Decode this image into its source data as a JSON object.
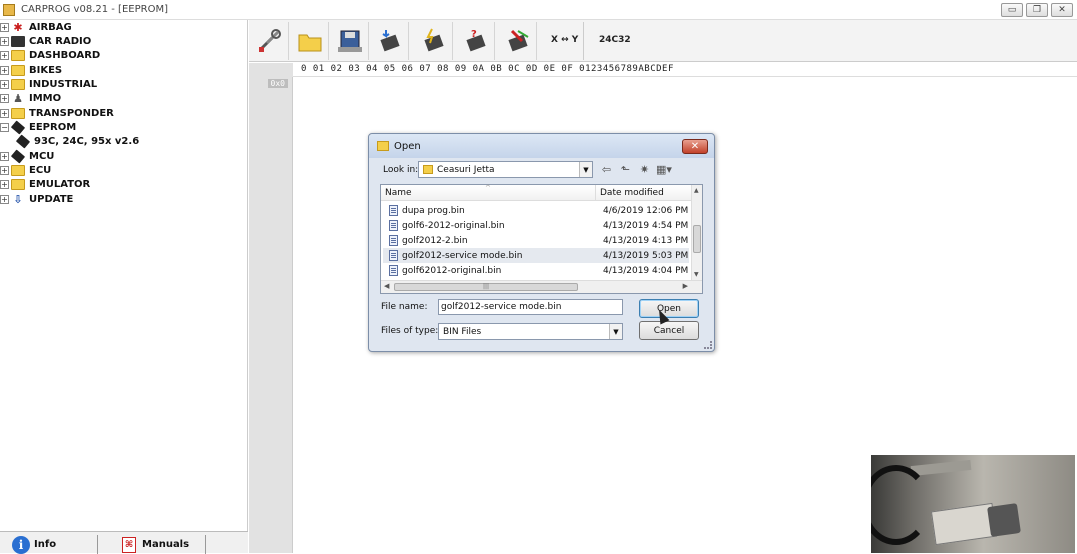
{
  "window": {
    "title": "CARPROG  v08.21 - [EEPROM]",
    "buttons": [
      "▭",
      "❐",
      "✕"
    ]
  },
  "tree": [
    {
      "label": "AIRBAG",
      "icon": "airbag-icon",
      "expander": "+"
    },
    {
      "label": "CAR RADIO",
      "icon": "car-radio-icon",
      "expander": "+"
    },
    {
      "label": "DASHBOARD",
      "icon": "folder-icon",
      "expander": "+"
    },
    {
      "label": "BIKES",
      "icon": "folder-icon",
      "expander": "+"
    },
    {
      "label": "INDUSTRIAL",
      "icon": "folder-icon",
      "expander": "+"
    },
    {
      "label": "IMMO",
      "icon": "person-icon",
      "expander": "+"
    },
    {
      "label": "TRANSPONDER",
      "icon": "folder-icon",
      "expander": "+"
    },
    {
      "label": "EEPROM",
      "icon": "chip-icon",
      "expander": "−"
    },
    {
      "label": "93C, 24C, 95x v2.6",
      "icon": "chip-icon",
      "expander": ""
    },
    {
      "label": "MCU",
      "icon": "chip-icon",
      "expander": "+"
    },
    {
      "label": "ECU",
      "icon": "folder-icon",
      "expander": "+"
    },
    {
      "label": "EMULATOR",
      "icon": "folder-icon",
      "expander": "+"
    },
    {
      "label": "UPDATE",
      "icon": "update-icon",
      "expander": "+"
    }
  ],
  "sidebar_bottom": {
    "info": "Info",
    "manuals": "Manuals"
  },
  "toolbar": {
    "xy_label": "X ↔ Y",
    "device": "24C32"
  },
  "hex": {
    "header": "0 01 02 03 04 05 06 07 08 09 0A 0B 0C 0D 0E 0F   0123456789ABCDEF",
    "first_address": "0x0"
  },
  "dialog": {
    "title": "Open",
    "look_in_label": "Look in:",
    "look_in_value": "Ceasuri Jetta",
    "col_name": "Name",
    "col_date": "Date modified",
    "files": [
      {
        "name": "dupa prog.bin",
        "date": "4/6/2019 12:06 PM"
      },
      {
        "name": "golf6-2012-original.bin",
        "date": "4/13/2019 4:54 PM"
      },
      {
        "name": "golf2012-2.bin",
        "date": "4/13/2019 4:13 PM"
      },
      {
        "name": "golf2012-service mode.bin",
        "date": "4/13/2019 5:03 PM"
      },
      {
        "name": "golf62012-original.bin",
        "date": "4/13/2019 4:04 PM"
      }
    ],
    "file_name_label": "File name:",
    "file_name_value": "golf2012-service mode.bin",
    "file_type_label": "Files of type:",
    "file_type_value": "BIN Files",
    "open_button": "Open",
    "cancel_button": "Cancel",
    "scroll_thumb": "|||"
  }
}
